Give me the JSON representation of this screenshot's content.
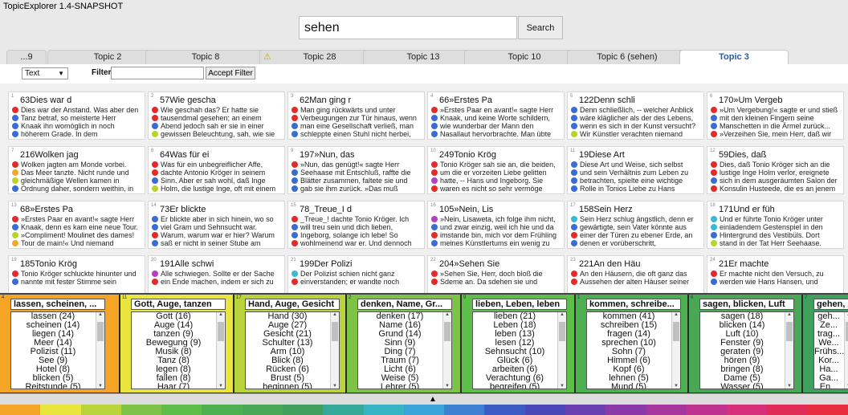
{
  "app": {
    "title": "TopicExplorer 1.4-SNAPSHOT"
  },
  "search": {
    "value": "sehen",
    "button_label": "Search"
  },
  "tabs": [
    {
      "label": "...9"
    },
    {
      "label": "Topic 2"
    },
    {
      "label": "Topic 8"
    },
    {
      "label": "Topic 28",
      "warning_icon": "warning-icon"
    },
    {
      "label": "Topic 13"
    },
    {
      "label": "Topic 10"
    },
    {
      "label": "Topic 6 (sehen)"
    },
    {
      "label": "Topic 3",
      "active": true
    }
  ],
  "filter": {
    "doc_type": "Text",
    "label": "Filter:",
    "value": "",
    "button_label": "Accept Filter"
  },
  "documents": [
    {
      "idx": "1",
      "title": "63Dies war d",
      "lines": [
        {
          "c": "#e52a2a",
          "t": "Dies war der Anstand. Was aber den"
        },
        {
          "c": "#3b6bd6",
          "t": "Tanz betraf, so meisterte Herr"
        },
        {
          "c": "#3b6bd6",
          "t": "Knaak ihn womöglich in noch"
        },
        {
          "c": "#3b6bd6",
          "t": "höherem Grade. In dem"
        }
      ]
    },
    {
      "idx": "2",
      "title": "57Wie gescha",
      "lines": [
        {
          "c": "#e52a2a",
          "t": "Wie geschah das? Er hatte sie"
        },
        {
          "c": "#e52a2a",
          "t": "tausendmal gesehen; an einem"
        },
        {
          "c": "#3b6bd6",
          "t": "Abend jedoch sah er sie in einer"
        },
        {
          "c": "#b8d42a",
          "t": "gewissen Beleuchtung, sah, wie sie"
        }
      ]
    },
    {
      "idx": "3",
      "title": "62Man ging r",
      "lines": [
        {
          "c": "#e52a2a",
          "t": "Man ging rückwärts und unter"
        },
        {
          "c": "#e52a2a",
          "t": "Verbeugungen zur Tür hinaus, wenn"
        },
        {
          "c": "#3b6bd6",
          "t": "man eine Gesellschaft verließ, man"
        },
        {
          "c": "#3b6bd6",
          "t": "schleppte einen Stuhl nicht herbei,"
        }
      ]
    },
    {
      "idx": "4",
      "title": "66»Erstes Pa",
      "lines": [
        {
          "c": "#e52a2a",
          "t": "»Erstes Paar en avant!« sagte Herr"
        },
        {
          "c": "#3b6bd6",
          "t": "Knaak, und keine Worte schildern,"
        },
        {
          "c": "#3b6bd6",
          "t": "wie wunderbar der Mann den"
        },
        {
          "c": "#3b6bd6",
          "t": "Nasallaut hervorbrachte. Man übte"
        }
      ]
    },
    {
      "idx": "5",
      "title": "122Denn schli",
      "lines": [
        {
          "c": "#3b6bd6",
          "t": "Denn schließlich, -- welcher Anblick"
        },
        {
          "c": "#3b6bd6",
          "t": "wäre kläglicher als der des Lebens,"
        },
        {
          "c": "#3b6bd6",
          "t": "wenn es sich in der Kunst versucht?"
        },
        {
          "c": "#b8d42a",
          "t": "Wir Künstler verachten niemand"
        }
      ]
    },
    {
      "idx": "6",
      "title": "170»Um Vergeb",
      "lines": [
        {
          "c": "#e52a2a",
          "t": "»Um Vergebung!« sagte er und stieß"
        },
        {
          "c": "#3b6bd6",
          "t": "mit den kleinen Fingern seine"
        },
        {
          "c": "#3b6bd6",
          "t": "Manschetten in die Ärmel zurück..."
        },
        {
          "c": "#e52a2a",
          "t": "»Verzeihen Sie, mein Herr, daß wir"
        }
      ]
    },
    {
      "idx": "7",
      "title": "216Wolken jag",
      "lines": [
        {
          "c": "#e52a2a",
          "t": "Wolken jagten am Monde vorbei."
        },
        {
          "c": "#f0a830",
          "t": "Das Meer tanzte. Nicht runde und"
        },
        {
          "c": "#b8d42a",
          "t": "gleichmäßige Wellen kamen in"
        },
        {
          "c": "#3b6bd6",
          "t": "Ordnung daher, sondern weithin, in"
        }
      ]
    },
    {
      "idx": "8",
      "title": "64Was für ei",
      "lines": [
        {
          "c": "#e52a2a",
          "t": "Was für ein unbegreiflicher Affe,"
        },
        {
          "c": "#e52a2a",
          "t": "dachte Antonio Kröger in seinem"
        },
        {
          "c": "#3b6bd6",
          "t": "Sinn. Aber er sah wohl, daß Inge"
        },
        {
          "c": "#b8d42a",
          "t": "Holm, die lustige Inge, oft mit einem"
        }
      ]
    },
    {
      "idx": "9",
      "title": "197»Nun, das",
      "lines": [
        {
          "c": "#e52a2a",
          "t": "»Nun, das genügt!« sagte Herr"
        },
        {
          "c": "#3b6bd6",
          "t": "Seehaase mit Entschluß, raffte die"
        },
        {
          "c": "#3b6bd6",
          "t": "Blätter zusammen, faltete sie und"
        },
        {
          "c": "#3b6bd6",
          "t": "gab sie ihm zurück. »Das muß"
        }
      ]
    },
    {
      "idx": "10",
      "title": "249Tonio Krög",
      "lines": [
        {
          "c": "#e52a2a",
          "t": "Tonio Kröger sah sie an, die beiden,"
        },
        {
          "c": "#e52a2a",
          "t": "um die er vorzeiten Liebe gelitten"
        },
        {
          "c": "#b540c6",
          "t": "hatte, -- Hans und Ingeborg. Sie"
        },
        {
          "c": "#e52a2a",
          "t": "waren es nicht so sehr vermöge"
        }
      ]
    },
    {
      "idx": "11",
      "title": "19Diese Art",
      "lines": [
        {
          "c": "#3b6bd6",
          "t": "Diese Art und Weise, sich selbst"
        },
        {
          "c": "#3b6bd6",
          "t": "und sein Verhältnis zum Leben zu"
        },
        {
          "c": "#3b6bd6",
          "t": "betrachten, spielte eine wichtige"
        },
        {
          "c": "#3b6bd6",
          "t": "Rolle in Tonios Liebe zu Hans"
        }
      ]
    },
    {
      "idx": "12",
      "title": "59Dies, daß",
      "lines": [
        {
          "c": "#e52a2a",
          "t": "Dies, daß Tonio Kröger sich an die"
        },
        {
          "c": "#e52a2a",
          "t": "lustige Inge Holm verlor, ereignete"
        },
        {
          "c": "#3b6bd6",
          "t": "sich in dem ausgeräumten Salon der"
        },
        {
          "c": "#e52a2a",
          "t": "Konsulin Husteede, die es an jenem"
        }
      ]
    },
    {
      "idx": "13",
      "title": "68»Erstes Pa",
      "lines": [
        {
          "c": "#e52a2a",
          "t": "»Erstes Paar en avant!« sagte Herr"
        },
        {
          "c": "#3b6bd6",
          "t": "Knaak, denn es kam eine neue Tour."
        },
        {
          "c": "#b8d42a",
          "t": "»Compliment! Moulinet des dames!"
        },
        {
          "c": "#f0a830",
          "t": "Tour de main!« Und niemand"
        }
      ]
    },
    {
      "idx": "14",
      "title": "73Er blickte",
      "lines": [
        {
          "c": "#3b6bd6",
          "t": "Er blickte aber in sich hinein, wo so"
        },
        {
          "c": "#3b6bd6",
          "t": "viel Gram und Sehnsucht war."
        },
        {
          "c": "#e52a2a",
          "t": "Warum, warum war er hier? Warum"
        },
        {
          "c": "#3b6bd6",
          "t": "saß er nicht in seiner Stube am"
        }
      ]
    },
    {
      "idx": "15",
      "title": "78_Treue_I d",
      "lines": [
        {
          "c": "#e52a2a",
          "t": "_Treue_! dachte Tonio Kröger. Ich"
        },
        {
          "c": "#3b6bd6",
          "t": "will treu sein und dich lieben,"
        },
        {
          "c": "#3b6bd6",
          "t": "Ingeborg, solange ich lebe! So"
        },
        {
          "c": "#e52a2a",
          "t": "wohlmeinend war er. Und dennoch"
        }
      ]
    },
    {
      "idx": "16",
      "title": "105»Nein, Lis",
      "lines": [
        {
          "c": "#b540c6",
          "t": "»Nein, Lisaweta, ich folge ihm nicht,"
        },
        {
          "c": "#3b6bd6",
          "t": "und zwar einzig, weil ich hie und da"
        },
        {
          "c": "#e52a2a",
          "t": "imstande bin, mich vor dem Frühling"
        },
        {
          "c": "#3b6bd6",
          "t": "meines Künstlertums ein wenig zu"
        }
      ]
    },
    {
      "idx": "17",
      "title": "158Sein Herz",
      "lines": [
        {
          "c": "#3bb8d8",
          "t": "Sein Herz schlug ängstlich, denn er"
        },
        {
          "c": "#3b6bd6",
          "t": "gewärtigte, sein Vater könnte aus"
        },
        {
          "c": "#e52a2a",
          "t": "einer der Türen zu ebener Erde, an"
        },
        {
          "c": "#3b6bd6",
          "t": "denen er vorüberschritt,"
        }
      ]
    },
    {
      "idx": "18",
      "title": "171Und er füh",
      "lines": [
        {
          "c": "#3bb8d8",
          "t": "Und er führte Tonio Kröger unter"
        },
        {
          "c": "#3bb8d8",
          "t": "einladendem Gestenspiel in den"
        },
        {
          "c": "#3b6bd6",
          "t": "Hintergrund des Vestibüls. Dort"
        },
        {
          "c": "#b8d42a",
          "t": "stand in der Tat Herr Seehaase."
        }
      ]
    },
    {
      "idx": "19",
      "title": "185Tonio Krög",
      "lines": [
        {
          "c": "#e52a2a",
          "t": "Tonio Kröger schluckte hinunter und"
        },
        {
          "c": "#3b6bd6",
          "t": "nannte mit fester Stimme sein"
        }
      ]
    },
    {
      "idx": "20",
      "title": "191Alle schwi",
      "lines": [
        {
          "c": "#b540c6",
          "t": "Alle schwiegen. Sollte er der Sache"
        },
        {
          "c": "#e52a2a",
          "t": "ein Ende machen, indem er sich zu"
        }
      ]
    },
    {
      "idx": "21",
      "title": "199Der Polizi",
      "lines": [
        {
          "c": "#3bb8d8",
          "t": "Der Polizist schien nicht ganz"
        },
        {
          "c": "#e52a2a",
          "t": "einverstanden; er wandte noch"
        }
      ]
    },
    {
      "idx": "22",
      "title": "204»Sehen Sie",
      "lines": [
        {
          "c": "#e52a2a",
          "t": "»Sehen Sie, Herr, doch bloß die"
        },
        {
          "c": "#e52a2a",
          "t": "Sdeme an. Da sdehen sie und"
        }
      ]
    },
    {
      "idx": "23",
      "title": "221An den Häu",
      "lines": [
        {
          "c": "#e52a2a",
          "t": "An den Häusern, die oft ganz das"
        },
        {
          "c": "#e52a2a",
          "t": "Aussehen der alten Häuser seiner"
        }
      ]
    },
    {
      "idx": "24",
      "title": "21Er machte",
      "lines": [
        {
          "c": "#e52a2a",
          "t": "Er machte nicht den Versuch, zu"
        },
        {
          "c": "#3b6bd6",
          "t": "werden wie Hans Hansen, und"
        }
      ]
    }
  ],
  "topics": [
    {
      "idx": "4",
      "color": "#f4a526",
      "title": "lassen, scheinen, ...",
      "words": [
        "lassen (24)",
        "scheinen (14)",
        "liegen (14)",
        "Meer (14)",
        "Polizist (11)",
        "See (9)",
        "Hotel (8)",
        "blicken (5)",
        "Reitstunde (5)"
      ]
    },
    {
      "idx": "11",
      "color": "#e9e53c",
      "title": "Gott, Auge, tanzen",
      "words": [
        "Gott (16)",
        "Auge (14)",
        "tanzen (9)",
        "Bewegung (9)",
        "Musik (8)",
        "Tanz (8)",
        "legen (8)",
        "fallen (8)",
        "Haar (7)"
      ]
    },
    {
      "idx": "17",
      "color": "#b9d43a",
      "title": "Hand, Auge, Gesicht",
      "words": [
        "Hand (30)",
        "Auge (27)",
        "Gesicht (21)",
        "Schulter (13)",
        "Arm (10)",
        "Blick (8)",
        "Rücken (6)",
        "Brust (5)",
        "beginnen (5)"
      ]
    },
    {
      "idx": "2",
      "color": "#7cc348",
      "title": "denken, Name, Gr...",
      "words": [
        "denken (17)",
        "Name (16)",
        "Grund (14)",
        "Sinn (9)",
        "Ding (7)",
        "Traum (7)",
        "Licht (6)",
        "Weise (5)",
        "Lehrer (5)"
      ]
    },
    {
      "idx": "9",
      "color": "#5ebe4a",
      "title": "lieben, Leben, leben",
      "words": [
        "lieben (21)",
        "Leben (18)",
        "leben (13)",
        "lesen (12)",
        "Sehnsucht (10)",
        "Glück (6)",
        "arbeiten (6)",
        "Verachtung (6)",
        "begreifen (5)"
      ]
    },
    {
      "idx": "1",
      "color": "#4cb050",
      "title": "kommen, schreibe...",
      "words": [
        "kommen (41)",
        "schreiben (15)",
        "fragen (14)",
        "sprechen (10)",
        "Sohn (7)",
        "Himmel (6)",
        "Kopf (6)",
        "lehnen (5)",
        "Mund (5)"
      ]
    },
    {
      "idx": "6",
      "color": "#48a856",
      "title": "sagen, blicken, Luft",
      "words": [
        "sagen (18)",
        "blicken (14)",
        "Luft (10)",
        "Fenster (9)",
        "geraten (9)",
        "hören (9)",
        "bringen (8)",
        "Dame (5)",
        "Wasser (5)"
      ]
    },
    {
      "idx": "7",
      "color": "#3f9f5c",
      "title": "gehen, Ze...",
      "words": [
        "geh...",
        "Ze...",
        "trag...",
        "We...",
        "Frühs...",
        "Kor...",
        "Ha...",
        "Ga...",
        "En..."
      ]
    }
  ],
  "color_strip": [
    "#f4a526",
    "#e9e53c",
    "#b9d43a",
    "#7cc348",
    "#5ebe4a",
    "#4cb050",
    "#48a856",
    "#3f9f5c",
    "#36a89a",
    "#34b4c4",
    "#3aa3d8",
    "#3d7fd0",
    "#3a5cc4",
    "#4a48b8",
    "#6a3fb0",
    "#8a3aa8",
    "#a6369e",
    "#c03290",
    "#d62e78",
    "#e22c58",
    "#e62c3e"
  ]
}
